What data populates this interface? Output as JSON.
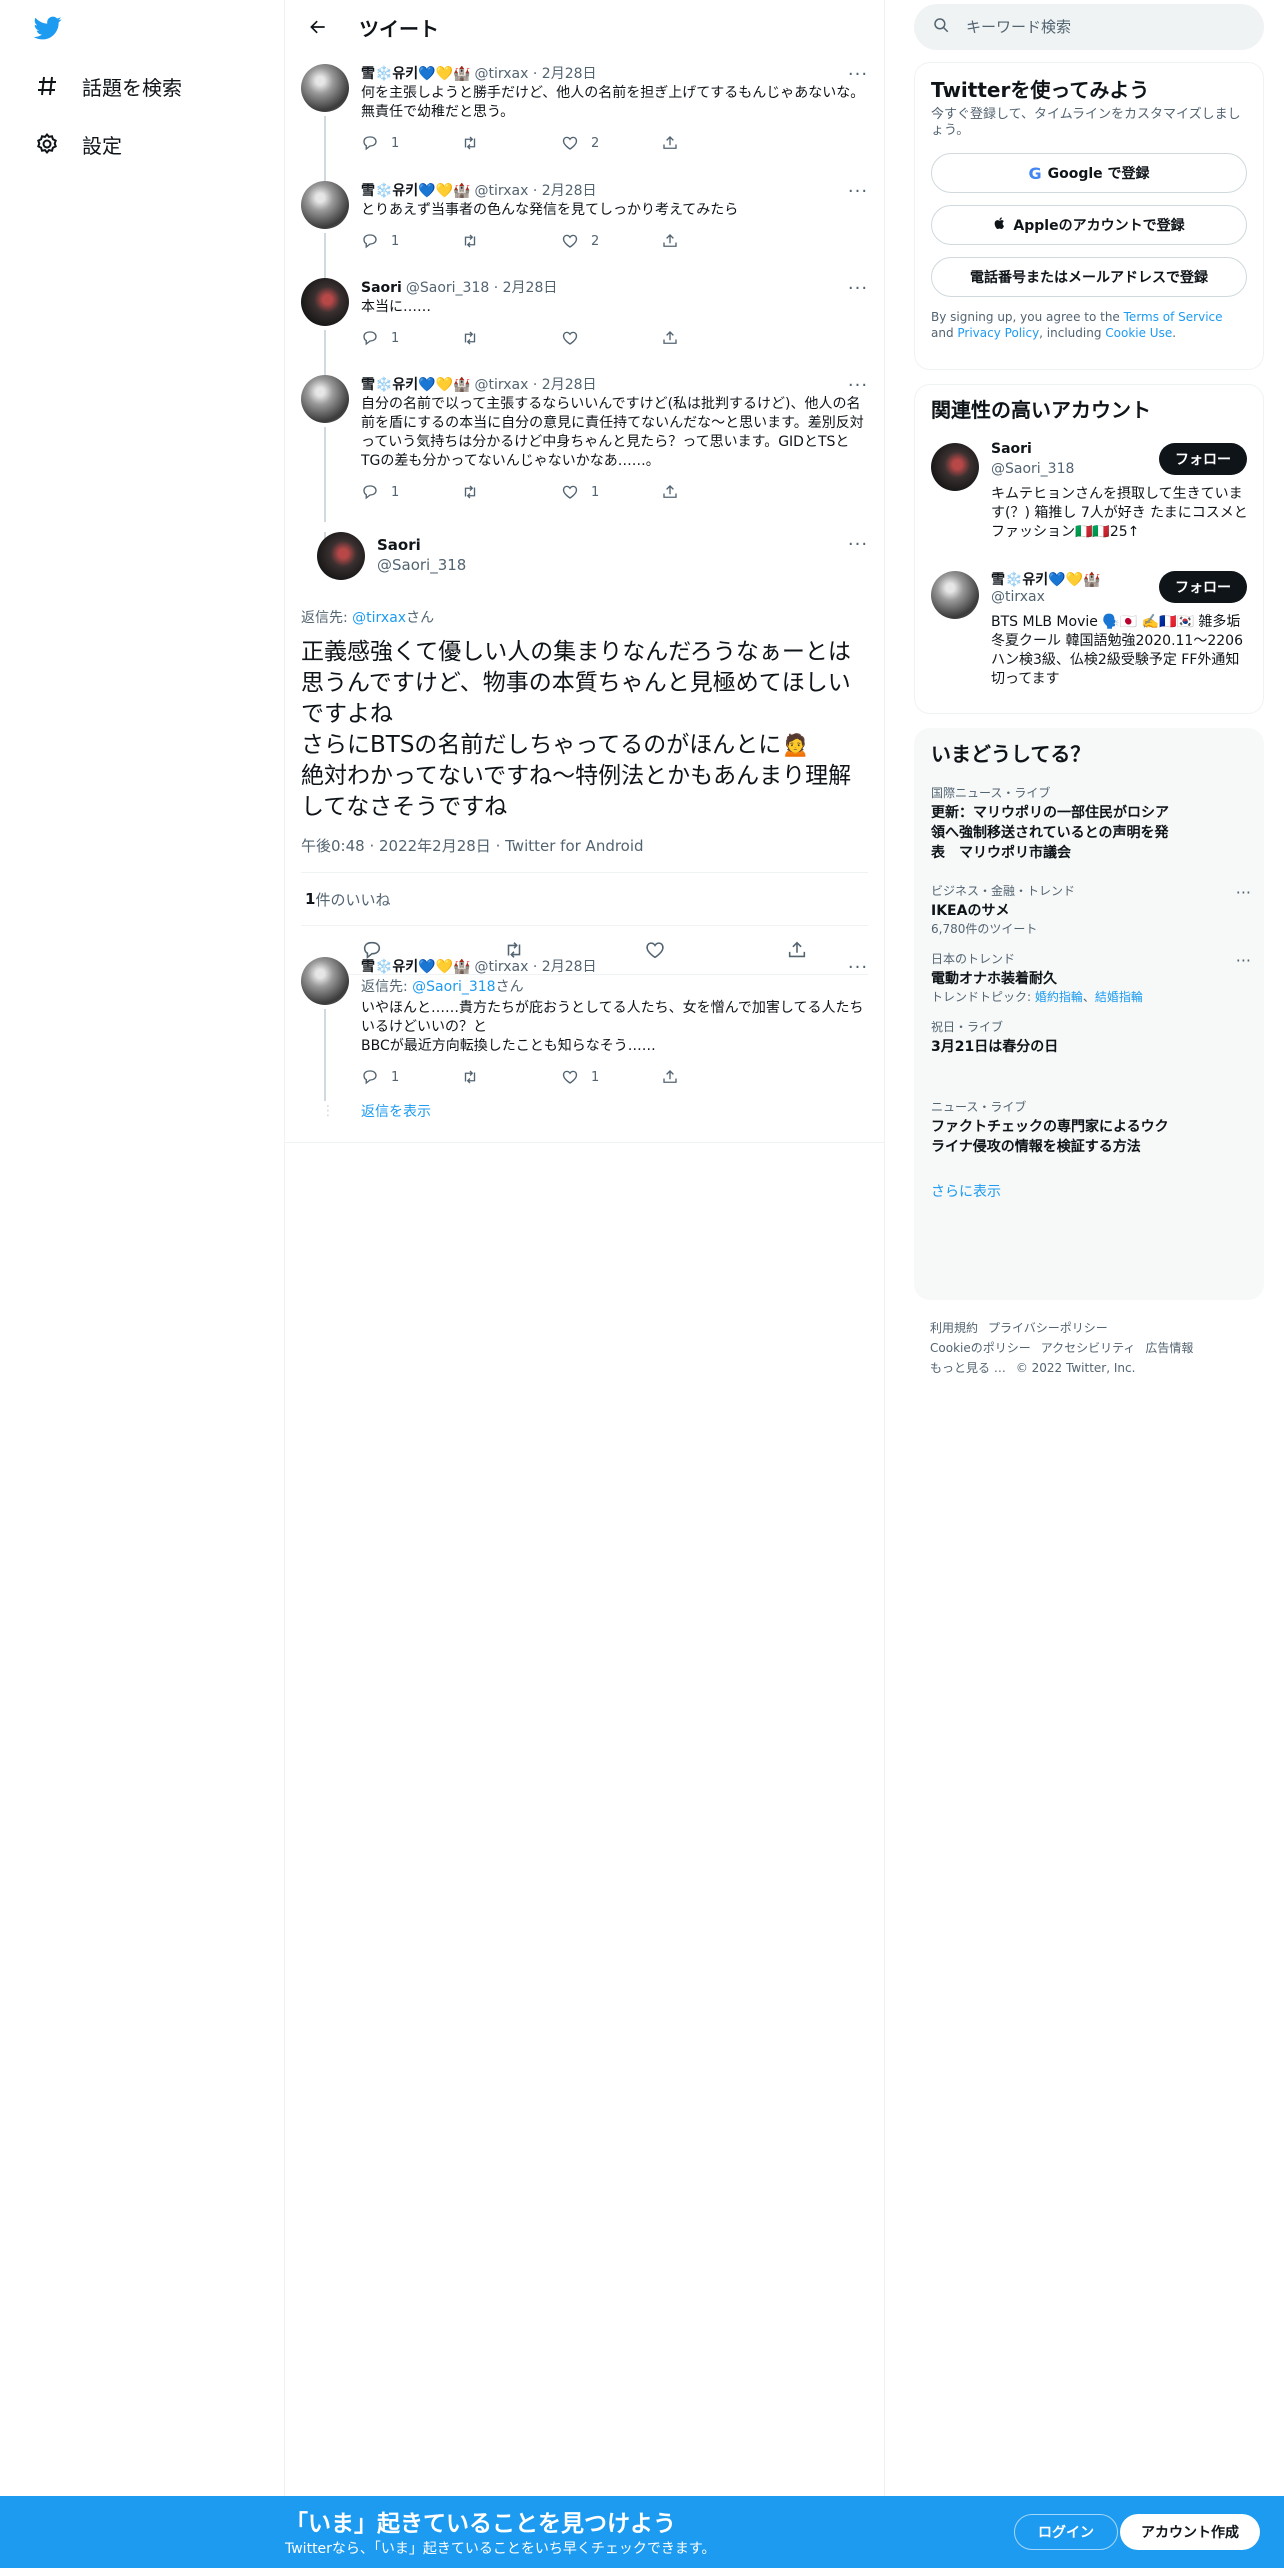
{
  "nav": {
    "explore_label": "話題を検索",
    "settings_label": "設定"
  },
  "header": {
    "title": "ツイート"
  },
  "tweets": [
    {
      "name": "雪❄️유키💙💛🏰",
      "handle": "@tirxax",
      "date": "2月28日",
      "text": "何を主張しようと勝手だけど、他人の名前を担ぎ上げてするもんじゃあないな。無責任で幼稚だと思う。",
      "replies": "1",
      "retweets": "",
      "likes": "2"
    },
    {
      "name": "雪❄️유키💙💛🏰",
      "handle": "@tirxax",
      "date": "2月28日",
      "text": "とりあえず当事者の色んな発信を見てしっかり考えてみたら",
      "replies": "1",
      "retweets": "",
      "likes": "2"
    },
    {
      "name": "Saori",
      "handle": "@Saori_318",
      "date": "2月28日",
      "text": "本当に……",
      "replies": "1",
      "retweets": "",
      "likes": ""
    },
    {
      "name": "雪❄️유키💙💛🏰",
      "handle": "@tirxax",
      "date": "2月28日",
      "text": "自分の名前で以って主張するならいいんですけど(私は批判するけど)、他人の名前を盾にするの本当に自分の意見に責任持てないんだな〜と思います。差別反対っていう気持ちは分かるけど中身ちゃんと見たら？って思います。GIDとTSとTGの差も分かってないんじゃないかなあ……。",
      "replies": "1",
      "retweets": "",
      "likes": "1"
    }
  ],
  "main_tweet": {
    "name": "Saori",
    "handle": "@Saori_318",
    "reply_prefix": "返信先: ",
    "reply_to": "@tirxax",
    "reply_suffix": "さん",
    "text": "正義感強くて優しい人の集まりなんだろうなぁーとは思うんですけど、物事の本質ちゃんと見極めてほしいですよね\nさらにBTSの名前だしちゃってるのがほんとに🙍\n絶対わかってないですね〜特例法とかもあんまり理解してなさそうですね",
    "time": "午後0:48",
    "date": "2022年2月28日",
    "client": "Twitter for Android",
    "like_count": "1",
    "like_label": " 件のいいね"
  },
  "reply_tweet": {
    "name": "雪❄️유키💙💛🏰",
    "handle": "@tirxax",
    "date": "2月28日",
    "reply_prefix": "返信先: ",
    "reply_to": "@Saori_318",
    "reply_suffix": "さん",
    "text": "いやほんと……貴方たちが庇おうとしてる人たち、女を憎んで加害してる人たちいるけどいいの？と\nBBCが最近方向転換したことも知らなそう……",
    "replies": "1",
    "retweets": "",
    "likes": "1",
    "show_replies": "返信を表示"
  },
  "search": {
    "placeholder": "キーワード検索"
  },
  "signup_panel": {
    "title": "Twitterを使ってみよう",
    "subtitle": "今すぐ登録して、タイムラインをカスタマイズしましょう。",
    "google_label": "Google で登録",
    "apple_label": "Appleのアカウントで登録",
    "phone_label": "電話番号またはメールアドレスで登録",
    "fine_1": "By signing up, you agree to the ",
    "terms": "Terms of Service",
    "fine_2": " and ",
    "privacy": "Privacy Policy",
    "fine_3": ", including ",
    "cookie": "Cookie Use",
    "fine_4": "."
  },
  "related": {
    "title": "関連性の高いアカウント",
    "follow_label": "フォロー",
    "accounts": [
      {
        "name": "Saori",
        "handle": "@Saori_318",
        "bio": "キムテヒョンさんを摂取して生きています(？) 箱推し 7人が好き たまにコスメとファッション🇮🇹🇮🇹25↑"
      },
      {
        "name": "雪❄️유키💙💛🏰",
        "handle": "@tirxax",
        "bio": "BTS MLB Movie 🗣️🇯🇵 ✍️🇫🇷🇰🇷 雑多垢 冬夏クール 韓国語勉強2020.11〜2206ハン検3級、仏検2級受験予定 FF外通知切ってます"
      }
    ]
  },
  "trends": {
    "title": "いまどうしてる？",
    "items": [
      {
        "category": "国際ニュース・ライブ",
        "title": "更新：マリウポリの一部住民がロシア領へ強制移送されているとの声明を発表　マリウポリ市議会",
        "sub": ""
      },
      {
        "category": "ビジネス・金融・トレンド",
        "title": "IKEAのサメ",
        "sub": "6,780件のツイート"
      },
      {
        "category": "日本のトレンド",
        "title": "電動オナホ装着耐久",
        "sub_prefix": "トレンドトピック: ",
        "links": [
          "婚約指輪",
          "結婚指輪"
        ]
      },
      {
        "category": "祝日・ライブ",
        "title": "3月21日は春分の日",
        "sub": ""
      },
      {
        "category": "ニュース・ライブ",
        "title": "ファクトチェックの専門家によるウクライナ侵攻の情報を検証する方法",
        "sub": ""
      }
    ],
    "show_more": "さらに表示"
  },
  "footer": {
    "links": [
      "利用規約",
      "プライバシーポリシー",
      "Cookieのポリシー",
      "アクセシビリティ",
      "広告情報",
      "もっと見る …"
    ],
    "copyright": "© 2022 Twitter, Inc."
  },
  "bottom_bar": {
    "title": "「いま」起きていることを見つけよう",
    "subtitle": "Twitterなら、「いま」起きていることをいち早くチェックできます。",
    "login": "ログイン",
    "signup": "アカウント作成"
  },
  "colors": {
    "accent": "#1d9bf0",
    "text": "#0f1419",
    "secondary": "#536471"
  }
}
